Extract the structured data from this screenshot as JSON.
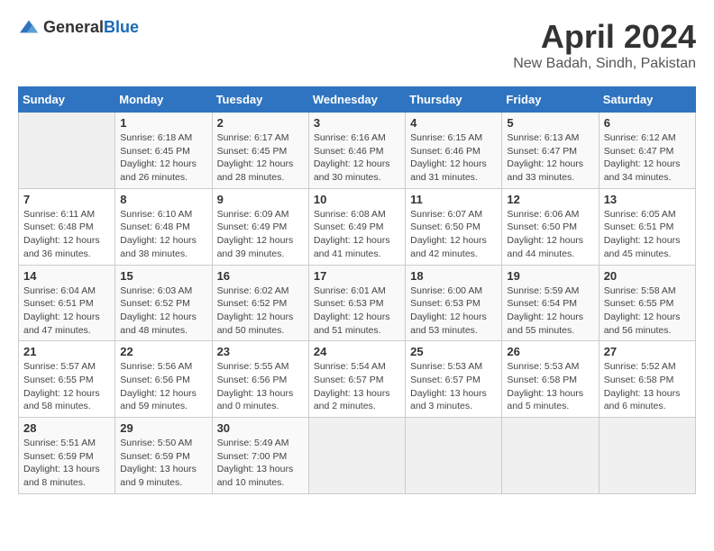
{
  "header": {
    "logo_general": "General",
    "logo_blue": "Blue",
    "title": "April 2024",
    "subtitle": "New Badah, Sindh, Pakistan"
  },
  "calendar": {
    "days_of_week": [
      "Sunday",
      "Monday",
      "Tuesday",
      "Wednesday",
      "Thursday",
      "Friday",
      "Saturday"
    ],
    "weeks": [
      [
        {
          "day": "",
          "info": ""
        },
        {
          "day": "1",
          "info": "Sunrise: 6:18 AM\nSunset: 6:45 PM\nDaylight: 12 hours\nand 26 minutes."
        },
        {
          "day": "2",
          "info": "Sunrise: 6:17 AM\nSunset: 6:45 PM\nDaylight: 12 hours\nand 28 minutes."
        },
        {
          "day": "3",
          "info": "Sunrise: 6:16 AM\nSunset: 6:46 PM\nDaylight: 12 hours\nand 30 minutes."
        },
        {
          "day": "4",
          "info": "Sunrise: 6:15 AM\nSunset: 6:46 PM\nDaylight: 12 hours\nand 31 minutes."
        },
        {
          "day": "5",
          "info": "Sunrise: 6:13 AM\nSunset: 6:47 PM\nDaylight: 12 hours\nand 33 minutes."
        },
        {
          "day": "6",
          "info": "Sunrise: 6:12 AM\nSunset: 6:47 PM\nDaylight: 12 hours\nand 34 minutes."
        }
      ],
      [
        {
          "day": "7",
          "info": "Sunrise: 6:11 AM\nSunset: 6:48 PM\nDaylight: 12 hours\nand 36 minutes."
        },
        {
          "day": "8",
          "info": "Sunrise: 6:10 AM\nSunset: 6:48 PM\nDaylight: 12 hours\nand 38 minutes."
        },
        {
          "day": "9",
          "info": "Sunrise: 6:09 AM\nSunset: 6:49 PM\nDaylight: 12 hours\nand 39 minutes."
        },
        {
          "day": "10",
          "info": "Sunrise: 6:08 AM\nSunset: 6:49 PM\nDaylight: 12 hours\nand 41 minutes."
        },
        {
          "day": "11",
          "info": "Sunrise: 6:07 AM\nSunset: 6:50 PM\nDaylight: 12 hours\nand 42 minutes."
        },
        {
          "day": "12",
          "info": "Sunrise: 6:06 AM\nSunset: 6:50 PM\nDaylight: 12 hours\nand 44 minutes."
        },
        {
          "day": "13",
          "info": "Sunrise: 6:05 AM\nSunset: 6:51 PM\nDaylight: 12 hours\nand 45 minutes."
        }
      ],
      [
        {
          "day": "14",
          "info": "Sunrise: 6:04 AM\nSunset: 6:51 PM\nDaylight: 12 hours\nand 47 minutes."
        },
        {
          "day": "15",
          "info": "Sunrise: 6:03 AM\nSunset: 6:52 PM\nDaylight: 12 hours\nand 48 minutes."
        },
        {
          "day": "16",
          "info": "Sunrise: 6:02 AM\nSunset: 6:52 PM\nDaylight: 12 hours\nand 50 minutes."
        },
        {
          "day": "17",
          "info": "Sunrise: 6:01 AM\nSunset: 6:53 PM\nDaylight: 12 hours\nand 51 minutes."
        },
        {
          "day": "18",
          "info": "Sunrise: 6:00 AM\nSunset: 6:53 PM\nDaylight: 12 hours\nand 53 minutes."
        },
        {
          "day": "19",
          "info": "Sunrise: 5:59 AM\nSunset: 6:54 PM\nDaylight: 12 hours\nand 55 minutes."
        },
        {
          "day": "20",
          "info": "Sunrise: 5:58 AM\nSunset: 6:55 PM\nDaylight: 12 hours\nand 56 minutes."
        }
      ],
      [
        {
          "day": "21",
          "info": "Sunrise: 5:57 AM\nSunset: 6:55 PM\nDaylight: 12 hours\nand 58 minutes."
        },
        {
          "day": "22",
          "info": "Sunrise: 5:56 AM\nSunset: 6:56 PM\nDaylight: 12 hours\nand 59 minutes."
        },
        {
          "day": "23",
          "info": "Sunrise: 5:55 AM\nSunset: 6:56 PM\nDaylight: 13 hours\nand 0 minutes."
        },
        {
          "day": "24",
          "info": "Sunrise: 5:54 AM\nSunset: 6:57 PM\nDaylight: 13 hours\nand 2 minutes."
        },
        {
          "day": "25",
          "info": "Sunrise: 5:53 AM\nSunset: 6:57 PM\nDaylight: 13 hours\nand 3 minutes."
        },
        {
          "day": "26",
          "info": "Sunrise: 5:53 AM\nSunset: 6:58 PM\nDaylight: 13 hours\nand 5 minutes."
        },
        {
          "day": "27",
          "info": "Sunrise: 5:52 AM\nSunset: 6:58 PM\nDaylight: 13 hours\nand 6 minutes."
        }
      ],
      [
        {
          "day": "28",
          "info": "Sunrise: 5:51 AM\nSunset: 6:59 PM\nDaylight: 13 hours\nand 8 minutes."
        },
        {
          "day": "29",
          "info": "Sunrise: 5:50 AM\nSunset: 6:59 PM\nDaylight: 13 hours\nand 9 minutes."
        },
        {
          "day": "30",
          "info": "Sunrise: 5:49 AM\nSunset: 7:00 PM\nDaylight: 13 hours\nand 10 minutes."
        },
        {
          "day": "",
          "info": ""
        },
        {
          "day": "",
          "info": ""
        },
        {
          "day": "",
          "info": ""
        },
        {
          "day": "",
          "info": ""
        }
      ]
    ]
  }
}
